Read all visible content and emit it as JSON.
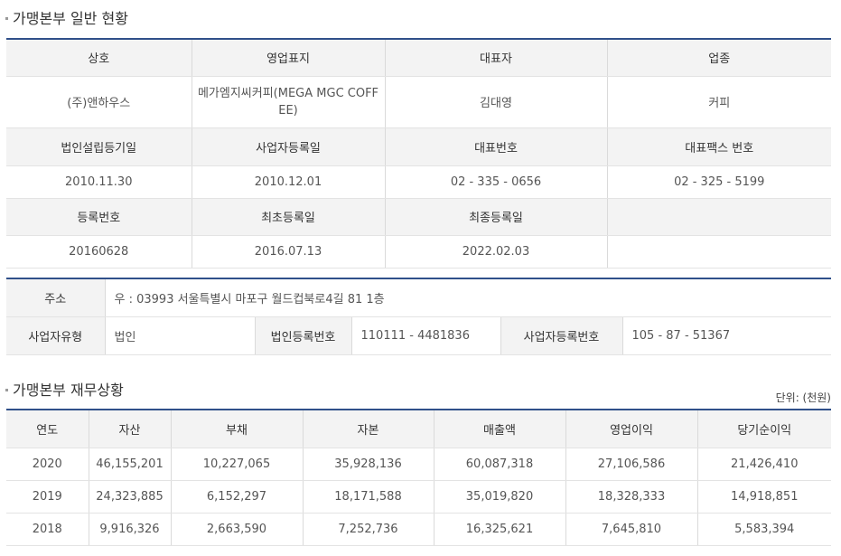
{
  "general": {
    "title": "가맹본부 일반 현황",
    "row1_headers": [
      "상호",
      "영업표지",
      "대표자",
      "업종"
    ],
    "row1_values": [
      "(주)앤하우스",
      "메가엠지씨커피(MEGA MGC COFFEE)",
      "김대영",
      "커피"
    ],
    "row2_headers": [
      "법인설립등기일",
      "사업자등록일",
      "대표번호",
      "대표팩스 번호"
    ],
    "row2_values": [
      "2010.11.30",
      "2010.12.01",
      "02 - 335 - 0656",
      "02 - 325 - 5199"
    ],
    "row3_headers": [
      "등록번호",
      "최초등록일",
      "최종등록일",
      ""
    ],
    "row3_values": [
      "20160628",
      "2016.07.13",
      "2022.02.03",
      ""
    ]
  },
  "address": {
    "address_label": "주소",
    "address_value": "우 : 03993 서울특별시 마포구 월드컵북로4길 81 1층",
    "biz_type_label": "사업자유형",
    "biz_type_value": "법인",
    "corp_no_label": "법인등록번호",
    "corp_no_value": "110111 - 4481836",
    "biz_no_label": "사업자등록번호",
    "biz_no_value": "105 - 87 - 51367"
  },
  "finance": {
    "title": "가맹본부 재무상황",
    "unit": "단위: (천원)",
    "headers": [
      "연도",
      "자산",
      "부채",
      "자본",
      "매출액",
      "영업이익",
      "당기순이익"
    ],
    "rows": [
      [
        "2020",
        "46,155,201",
        "10,227,065",
        "35,928,136",
        "60,087,318",
        "27,106,586",
        "21,426,410"
      ],
      [
        "2019",
        "24,323,885",
        "6,152,297",
        "18,171,588",
        "35,019,820",
        "18,328,333",
        "14,918,851"
      ],
      [
        "2018",
        "9,916,326",
        "2,663,590",
        "7,252,736",
        "16,325,621",
        "7,645,810",
        "5,583,394"
      ]
    ]
  }
}
